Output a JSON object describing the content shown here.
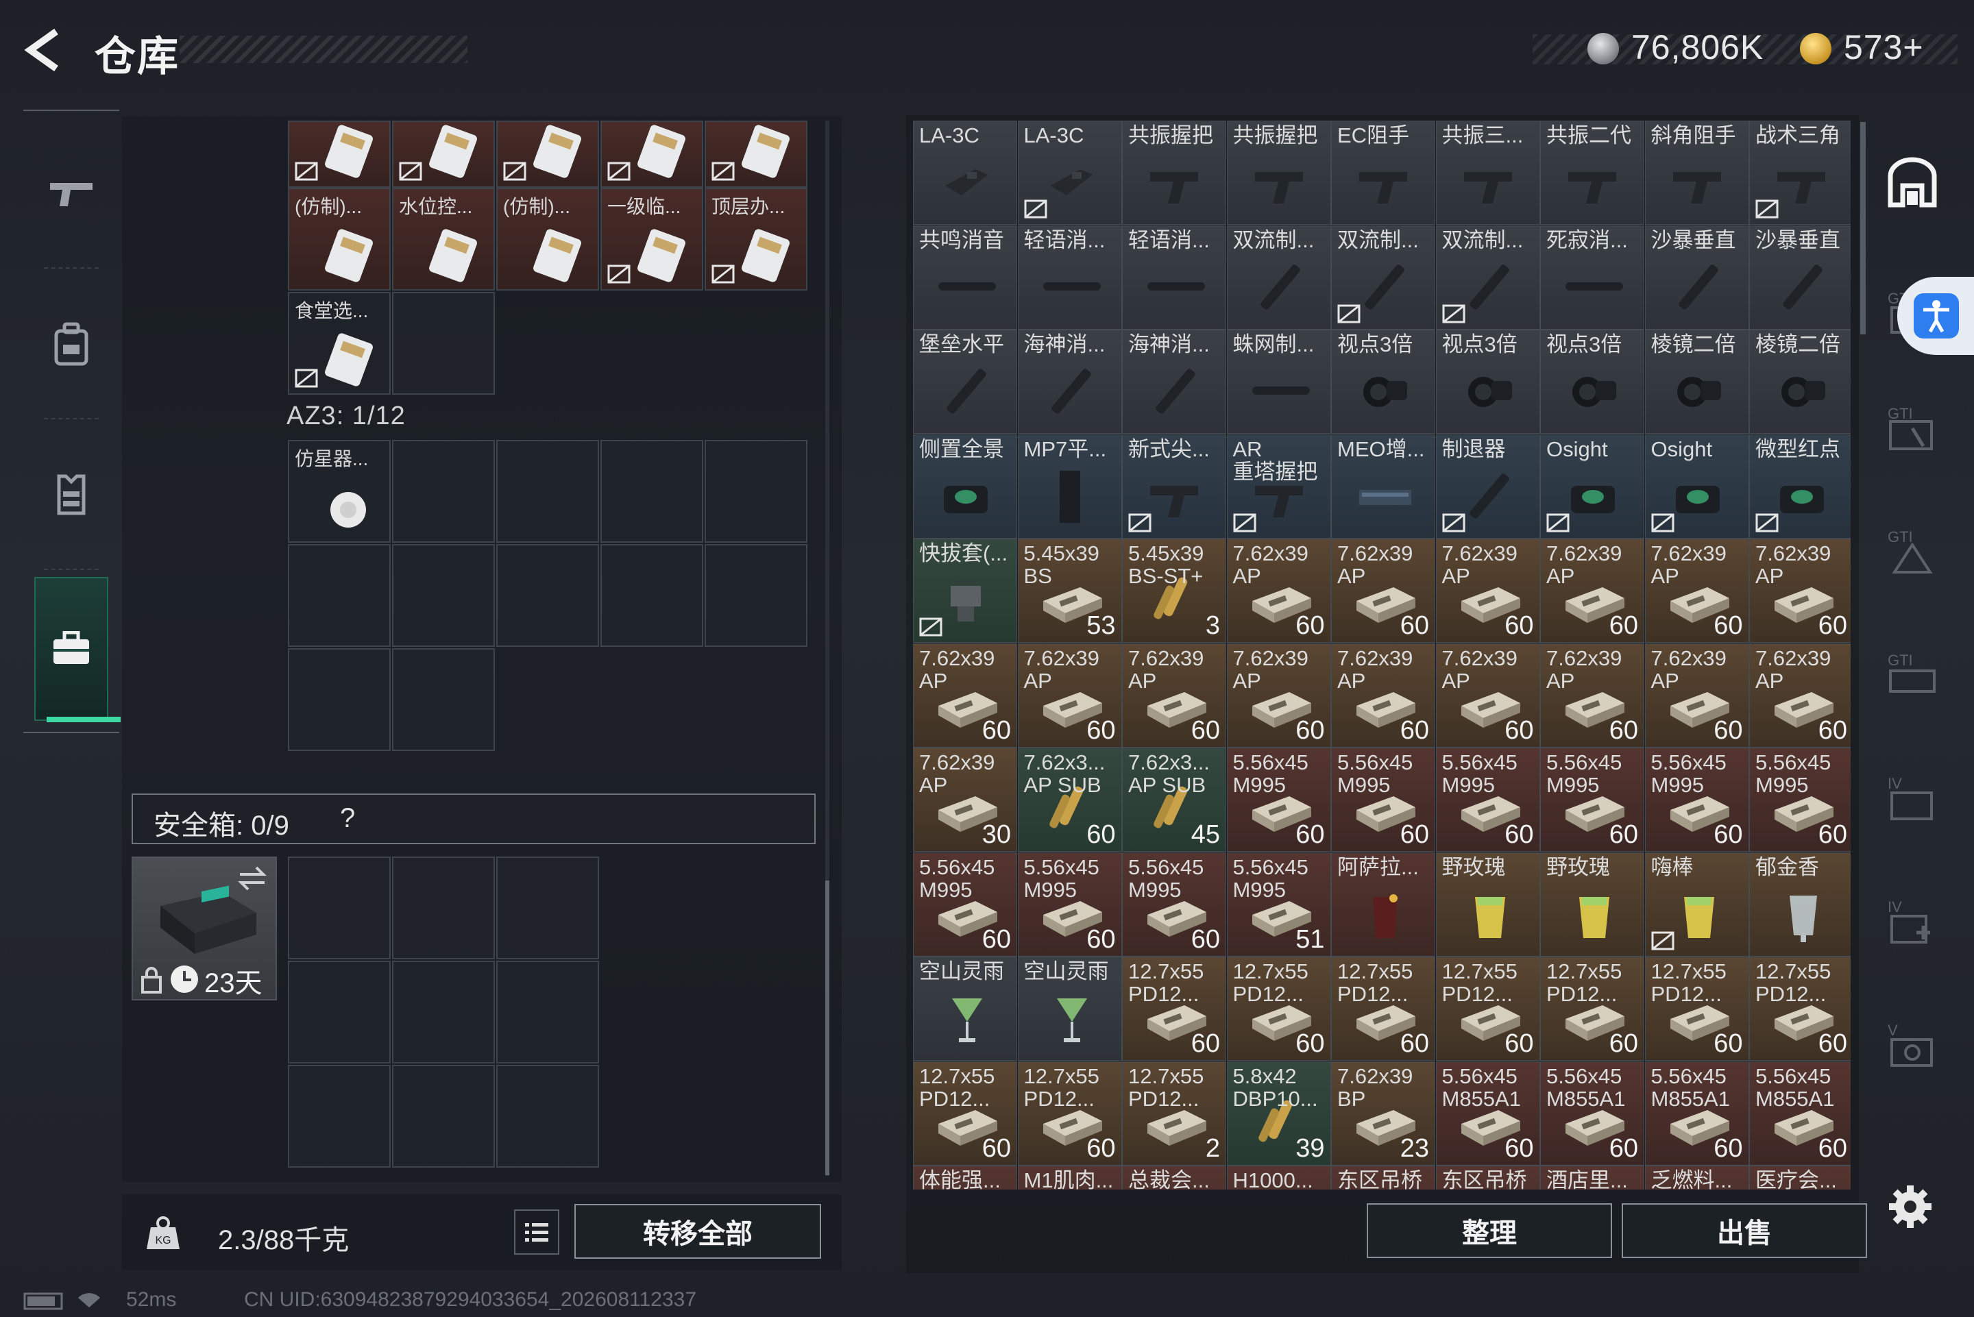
{
  "header": {
    "title": "仓库",
    "currency_1": "76,806K",
    "currency_2": "573+"
  },
  "left_nav": [
    "weapon-icon",
    "backpack-icon",
    "vest-icon",
    "case-icon"
  ],
  "left_panel": {
    "top_row_items": [
      "",
      "",
      "",
      "",
      ""
    ],
    "row2_items": [
      "(仿制)...",
      "水位控...",
      "(仿制)...",
      "一级临...",
      "顶层办..."
    ],
    "row3_items": [
      "食堂选..."
    ],
    "az3_label": "AZ3: 1/12",
    "az3_item": "仿星器...",
    "safebox_label": "安全箱: 0/9",
    "safebox_help": "?",
    "safecase_days": "23天",
    "weight": "2.3/88千克",
    "transfer_all": "转移全部"
  },
  "status": {
    "ping": "52ms",
    "uid": "CN UID:63094823879294033654_202608112337"
  },
  "grid_items": [
    {
      "label": "LA-3C",
      "count": "",
      "color": "gray",
      "lock": false,
      "icon": "attachment"
    },
    {
      "label": "LA-3C",
      "count": "",
      "color": "gray",
      "lock": true,
      "icon": "attachment"
    },
    {
      "label": "共振握把",
      "count": "",
      "color": "gray",
      "lock": false,
      "icon": "grip"
    },
    {
      "label": "共振握把",
      "count": "",
      "color": "gray",
      "lock": false,
      "icon": "grip"
    },
    {
      "label": "EC阻手",
      "count": "",
      "color": "gray",
      "lock": false,
      "icon": "grip"
    },
    {
      "label": "共振三...",
      "count": "",
      "color": "gray",
      "lock": false,
      "icon": "grip"
    },
    {
      "label": "共振二代",
      "count": "",
      "color": "gray",
      "lock": false,
      "icon": "grip"
    },
    {
      "label": "斜角阻手",
      "count": "",
      "color": "gray",
      "lock": false,
      "icon": "grip"
    },
    {
      "label": "战术三角",
      "count": "",
      "color": "gray",
      "lock": true,
      "icon": "grip"
    },
    {
      "label": "共鸣消音",
      "count": "",
      "color": "gray",
      "lock": false,
      "icon": "suppressor"
    },
    {
      "label": "轻语消...",
      "count": "",
      "color": "gray",
      "lock": false,
      "icon": "suppressor"
    },
    {
      "label": "轻语消...",
      "count": "",
      "color": "gray",
      "lock": false,
      "icon": "suppressor"
    },
    {
      "label": "双流制...",
      "count": "",
      "color": "gray",
      "lock": false,
      "icon": "muzzle"
    },
    {
      "label": "双流制...",
      "count": "",
      "color": "gray",
      "lock": true,
      "icon": "muzzle"
    },
    {
      "label": "双流制...",
      "count": "",
      "color": "gray",
      "lock": true,
      "icon": "muzzle"
    },
    {
      "label": "死寂消...",
      "count": "",
      "color": "gray",
      "lock": false,
      "icon": "suppressor"
    },
    {
      "label": "沙暴垂直",
      "count": "",
      "color": "gray",
      "lock": false,
      "icon": "muzzle"
    },
    {
      "label": "沙暴垂直",
      "count": "",
      "color": "gray",
      "lock": false,
      "icon": "muzzle"
    },
    {
      "label": "堡垒水平",
      "count": "",
      "color": "gray",
      "lock": false,
      "icon": "muzzle"
    },
    {
      "label": "海神消...",
      "count": "",
      "color": "gray",
      "lock": false,
      "icon": "muzzle"
    },
    {
      "label": "海神消...",
      "count": "",
      "color": "gray",
      "lock": false,
      "icon": "muzzle"
    },
    {
      "label": "蛛网制...",
      "count": "",
      "color": "gray",
      "lock": false,
      "icon": "suppressor"
    },
    {
      "label": "视点3倍",
      "count": "",
      "color": "gray",
      "lock": false,
      "icon": "scope"
    },
    {
      "label": "视点3倍",
      "count": "",
      "color": "gray",
      "lock": false,
      "icon": "scope"
    },
    {
      "label": "视点3倍",
      "count": "",
      "color": "gray",
      "lock": false,
      "icon": "scope"
    },
    {
      "label": "棱镜二倍",
      "count": "",
      "color": "gray",
      "lock": false,
      "icon": "scope"
    },
    {
      "label": "棱镜二倍",
      "count": "",
      "color": "gray",
      "lock": false,
      "icon": "scope"
    },
    {
      "label": "侧置全景",
      "count": "",
      "color": "blue",
      "lock": false,
      "icon": "sight"
    },
    {
      "label": "MP7平...",
      "count": "",
      "color": "blue",
      "lock": false,
      "icon": "stock"
    },
    {
      "label": "新式尖...",
      "count": "",
      "color": "blue",
      "lock": true,
      "icon": "grip"
    },
    {
      "label": "AR\n重塔握把",
      "count": "",
      "color": "blue",
      "lock": true,
      "icon": "grip"
    },
    {
      "label": "MEO增...",
      "count": "",
      "color": "blue",
      "lock": false,
      "icon": "rail"
    },
    {
      "label": "制退器",
      "count": "",
      "color": "blue",
      "lock": true,
      "icon": "muzzle"
    },
    {
      "label": "Osight",
      "count": "",
      "color": "blue",
      "lock": true,
      "icon": "sight"
    },
    {
      "label": "Osight",
      "count": "",
      "color": "blue",
      "lock": true,
      "icon": "sight"
    },
    {
      "label": "微型红点",
      "count": "",
      "color": "blue",
      "lock": true,
      "icon": "sight"
    },
    {
      "label": "快拔套(...",
      "count": "",
      "color": "green",
      "lock": true,
      "icon": "mount"
    },
    {
      "label": "5.45x39\nBS",
      "count": "53",
      "color": "brown",
      "lock": false,
      "icon": "ammo"
    },
    {
      "label": "5.45x39\nBS-ST+",
      "count": "3",
      "color": "brown",
      "lock": false,
      "icon": "bullet"
    },
    {
      "label": "7.62x39\nAP",
      "count": "60",
      "color": "brown",
      "lock": false,
      "icon": "ammo"
    },
    {
      "label": "7.62x39\nAP",
      "count": "60",
      "color": "brown",
      "lock": false,
      "icon": "ammo"
    },
    {
      "label": "7.62x39\nAP",
      "count": "60",
      "color": "brown",
      "lock": false,
      "icon": "ammo"
    },
    {
      "label": "7.62x39\nAP",
      "count": "60",
      "color": "brown",
      "lock": false,
      "icon": "ammo"
    },
    {
      "label": "7.62x39\nAP",
      "count": "60",
      "color": "brown",
      "lock": false,
      "icon": "ammo"
    },
    {
      "label": "7.62x39\nAP",
      "count": "60",
      "color": "brown",
      "lock": false,
      "icon": "ammo"
    },
    {
      "label": "7.62x39\nAP",
      "count": "60",
      "color": "brown",
      "lock": false,
      "icon": "ammo"
    },
    {
      "label": "7.62x39\nAP",
      "count": "60",
      "color": "brown",
      "lock": false,
      "icon": "ammo"
    },
    {
      "label": "7.62x39\nAP",
      "count": "60",
      "color": "brown",
      "lock": false,
      "icon": "ammo"
    },
    {
      "label": "7.62x39\nAP",
      "count": "60",
      "color": "brown",
      "lock": false,
      "icon": "ammo"
    },
    {
      "label": "7.62x39\nAP",
      "count": "60",
      "color": "brown",
      "lock": false,
      "icon": "ammo"
    },
    {
      "label": "7.62x39\nAP",
      "count": "60",
      "color": "brown",
      "lock": false,
      "icon": "ammo"
    },
    {
      "label": "7.62x39\nAP",
      "count": "60",
      "color": "brown",
      "lock": false,
      "icon": "ammo"
    },
    {
      "label": "7.62x39\nAP",
      "count": "60",
      "color": "brown",
      "lock": false,
      "icon": "ammo"
    },
    {
      "label": "7.62x39\nAP",
      "count": "60",
      "color": "brown",
      "lock": false,
      "icon": "ammo"
    },
    {
      "label": "7.62x39\nAP",
      "count": "30",
      "color": "brown",
      "lock": false,
      "icon": "ammo"
    },
    {
      "label": "7.62x3...\nAP SUB",
      "count": "60",
      "color": "green",
      "lock": false,
      "icon": "bullet"
    },
    {
      "label": "7.62x3...\nAP SUB",
      "count": "45",
      "color": "green",
      "lock": false,
      "icon": "bullet"
    },
    {
      "label": "5.56x45\nM995",
      "count": "60",
      "color": "red",
      "lock": false,
      "icon": "ammo"
    },
    {
      "label": "5.56x45\nM995",
      "count": "60",
      "color": "red",
      "lock": false,
      "icon": "ammo"
    },
    {
      "label": "5.56x45\nM995",
      "count": "60",
      "color": "red",
      "lock": false,
      "icon": "ammo"
    },
    {
      "label": "5.56x45\nM995",
      "count": "60",
      "color": "red",
      "lock": false,
      "icon": "ammo"
    },
    {
      "label": "5.56x45\nM995",
      "count": "60",
      "color": "red",
      "lock": false,
      "icon": "ammo"
    },
    {
      "label": "5.56x45\nM995",
      "count": "60",
      "color": "red",
      "lock": false,
      "icon": "ammo"
    },
    {
      "label": "5.56x45\nM995",
      "count": "60",
      "color": "red",
      "lock": false,
      "icon": "ammo"
    },
    {
      "label": "5.56x45\nM995",
      "count": "60",
      "color": "red",
      "lock": false,
      "icon": "ammo"
    },
    {
      "label": "5.56x45\nM995",
      "count": "60",
      "color": "red",
      "lock": false,
      "icon": "ammo"
    },
    {
      "label": "5.56x45\nM995",
      "count": "51",
      "color": "red",
      "lock": false,
      "icon": "ammo"
    },
    {
      "label": "阿萨拉...",
      "count": "",
      "color": "red",
      "lock": false,
      "icon": "drink-dark"
    },
    {
      "label": "野玫瑰",
      "count": "",
      "color": "brown",
      "lock": false,
      "icon": "drink-yellow"
    },
    {
      "label": "野玫瑰",
      "count": "",
      "color": "brown",
      "lock": false,
      "icon": "drink-yellow"
    },
    {
      "label": "嗨棒",
      "count": "",
      "color": "brown",
      "lock": true,
      "icon": "drink-yellow"
    },
    {
      "label": "郁金香",
      "count": "",
      "color": "brown",
      "lock": false,
      "icon": "drink-clear"
    },
    {
      "label": "空山灵雨",
      "count": "",
      "color": "gray",
      "lock": false,
      "icon": "drink-green"
    },
    {
      "label": "空山灵雨",
      "count": "",
      "color": "gray",
      "lock": false,
      "icon": "drink-green"
    },
    {
      "label": "12.7x55\nPD12...",
      "count": "60",
      "color": "brown",
      "lock": false,
      "icon": "ammo"
    },
    {
      "label": "12.7x55\nPD12...",
      "count": "60",
      "color": "brown",
      "lock": false,
      "icon": "ammo"
    },
    {
      "label": "12.7x55\nPD12...",
      "count": "60",
      "color": "brown",
      "lock": false,
      "icon": "ammo"
    },
    {
      "label": "12.7x55\nPD12...",
      "count": "60",
      "color": "brown",
      "lock": false,
      "icon": "ammo"
    },
    {
      "label": "12.7x55\nPD12...",
      "count": "60",
      "color": "brown",
      "lock": false,
      "icon": "ammo"
    },
    {
      "label": "12.7x55\nPD12...",
      "count": "60",
      "color": "brown",
      "lock": false,
      "icon": "ammo"
    },
    {
      "label": "12.7x55\nPD12...",
      "count": "60",
      "color": "brown",
      "lock": false,
      "icon": "ammo"
    },
    {
      "label": "12.7x55\nPD12...",
      "count": "60",
      "color": "brown",
      "lock": false,
      "icon": "ammo"
    },
    {
      "label": "12.7x55\nPD12...",
      "count": "60",
      "color": "brown",
      "lock": false,
      "icon": "ammo"
    },
    {
      "label": "12.7x55\nPD12...",
      "count": "2",
      "color": "brown",
      "lock": false,
      "icon": "ammo"
    },
    {
      "label": "5.8x42\nDBP10...",
      "count": "39",
      "color": "green",
      "lock": false,
      "icon": "bullet"
    },
    {
      "label": "7.62x39\nBP",
      "count": "23",
      "color": "brown",
      "lock": false,
      "icon": "ammo"
    },
    {
      "label": "5.56x45\nM855A1",
      "count": "60",
      "color": "red",
      "lock": false,
      "icon": "ammo"
    },
    {
      "label": "5.56x45\nM855A1",
      "count": "60",
      "color": "red",
      "lock": false,
      "icon": "ammo"
    },
    {
      "label": "5.56x45\nM855A1",
      "count": "60",
      "color": "red",
      "lock": false,
      "icon": "ammo"
    },
    {
      "label": "5.56x45\nM855A1",
      "count": "60",
      "color": "red",
      "lock": false,
      "icon": "ammo"
    },
    {
      "label": "体能强...",
      "count": "",
      "color": "red",
      "lock": false,
      "icon": "none"
    },
    {
      "label": "M1肌肉...",
      "count": "",
      "color": "red",
      "lock": false,
      "icon": "none"
    },
    {
      "label": "总裁会...",
      "count": "",
      "color": "red",
      "lock": false,
      "icon": "none"
    },
    {
      "label": "H1000...",
      "count": "",
      "color": "red",
      "lock": false,
      "icon": "none"
    },
    {
      "label": "东区吊桥",
      "count": "",
      "color": "red",
      "lock": false,
      "icon": "none"
    },
    {
      "label": "东区吊桥",
      "count": "",
      "color": "red",
      "lock": false,
      "icon": "none"
    },
    {
      "label": "酒店里...",
      "count": "",
      "color": "red",
      "lock": false,
      "icon": "none"
    },
    {
      "label": "乏燃料...",
      "count": "",
      "color": "red",
      "lock": false,
      "icon": "none"
    },
    {
      "label": "医疗会...",
      "count": "",
      "color": "red",
      "lock": false,
      "icon": "none"
    }
  ],
  "bottom_buttons": {
    "sort": "整理",
    "sell": "出售"
  },
  "right_nav": [
    "storage-icon",
    "gti-1-icon",
    "gti-2-icon",
    "gti-3-icon",
    "iv-1-icon",
    "iv-2-icon",
    "v-icon"
  ],
  "colors": {
    "accent": "#3dd9a3",
    "ammo_brown": "#5a4632",
    "ammo_red": "#553530",
    "blue": "#33404c",
    "green": "#34483f"
  }
}
